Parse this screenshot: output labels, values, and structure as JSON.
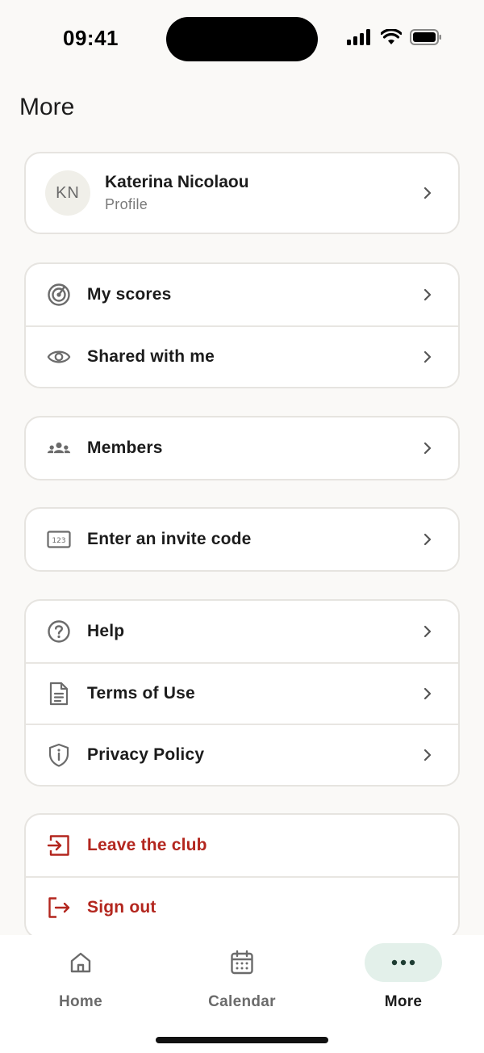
{
  "status_bar": {
    "time": "09:41"
  },
  "header": {
    "title": "More"
  },
  "profile": {
    "initials": "KN",
    "name": "Katerina Nicolaou",
    "subtitle": "Profile"
  },
  "groups": {
    "scores": [
      {
        "label": "My scores",
        "icon": "target-icon"
      },
      {
        "label": "Shared with me",
        "icon": "eye-icon"
      }
    ],
    "members": [
      {
        "label": "Members",
        "icon": "group-icon"
      }
    ],
    "invite": [
      {
        "label": "Enter an invite code",
        "icon": "numeric-code-icon"
      }
    ],
    "info": [
      {
        "label": "Help",
        "icon": "help-circle-icon"
      },
      {
        "label": "Terms of Use",
        "icon": "document-icon"
      },
      {
        "label": "Privacy Policy",
        "icon": "shield-info-icon"
      }
    ],
    "account": [
      {
        "label": "Leave the club",
        "icon": "exit-icon"
      },
      {
        "label": "Sign out",
        "icon": "logout-icon"
      }
    ]
  },
  "tabs": [
    {
      "label": "Home",
      "icon": "home-icon"
    },
    {
      "label": "Calendar",
      "icon": "calendar-icon"
    },
    {
      "label": "More",
      "icon": "more-dots-icon",
      "active": true
    }
  ],
  "colors": {
    "danger": "#b3261e",
    "active_tab_bg": "#e3f0ea",
    "icon_gray": "#6b6b6b"
  }
}
